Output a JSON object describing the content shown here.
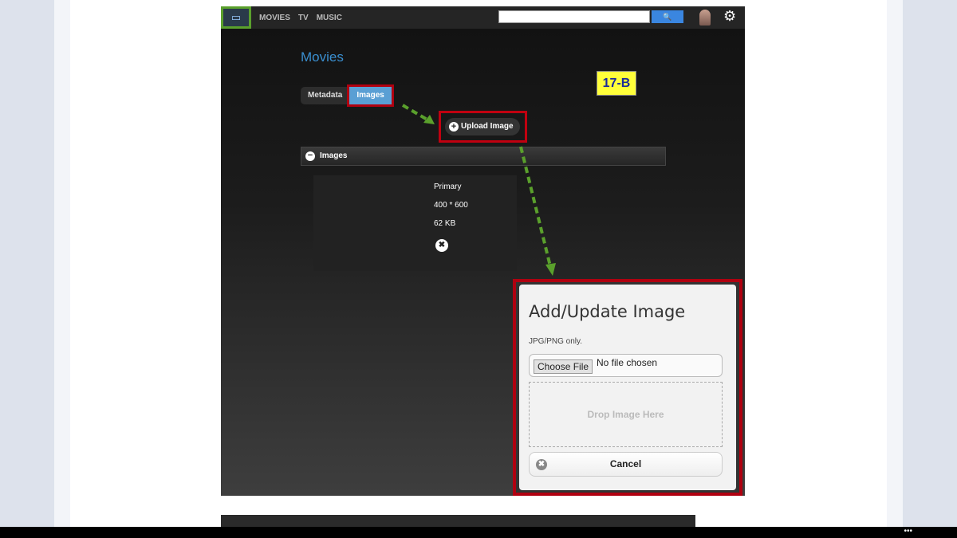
{
  "nav": {
    "items": [
      "MOVIES",
      "TV",
      "MUSIC"
    ],
    "search_placeholder": "",
    "search_icon": "🔍",
    "gear_icon": "⚙"
  },
  "page": {
    "title": "Movies",
    "tabs": [
      "Metadata",
      "Images"
    ],
    "badge": "17-B",
    "upload_label": "Upload Image",
    "section_label": "Images"
  },
  "image": {
    "type": "Primary",
    "dimensions": "400 * 600",
    "size": "62 KB"
  },
  "dialog": {
    "title": "Add/Update Image",
    "note": "JPG/PNG only.",
    "choose_file": "Choose File",
    "no_file": "No file chosen",
    "drop": "Drop Image Here",
    "cancel": "Cancel"
  },
  "colors": {
    "accent": "#3a8fd0",
    "highlight": "#b00010",
    "arrow": "#5aa02c"
  }
}
